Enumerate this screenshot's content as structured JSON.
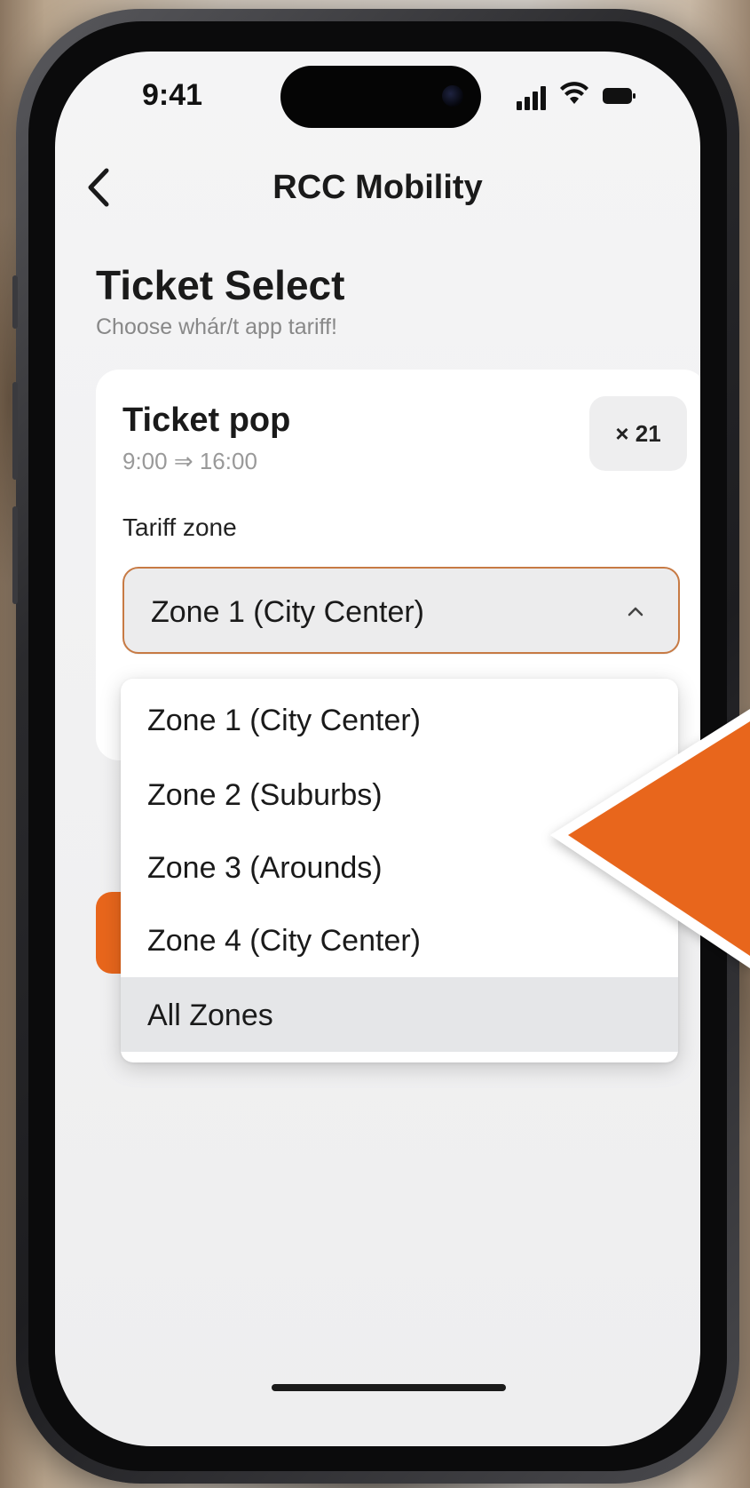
{
  "status_bar": {
    "time": "9:41"
  },
  "nav": {
    "title": "RCC Mobility"
  },
  "page": {
    "title": "Ticket Select",
    "subtitle": "Choose whár/t app tariff!"
  },
  "ticket": {
    "name": "Ticket pop",
    "time_range": "9:00 ⇒ 16:00",
    "quantity": "× 21"
  },
  "tariff": {
    "label": "Tariff zone",
    "selected": "Zone 1 (City Center)",
    "options": [
      "Zone 1 (City Center)",
      "Zone 2 (Suburbs)",
      "Zone 3 (Arounds)",
      "Zone 4 (City Center)",
      "All Zones"
    ],
    "highlighted_option": "All Zones"
  },
  "colors": {
    "accent": "#e8661c",
    "select_border": "#c77a44",
    "highlight_row": "#e5e6e8"
  },
  "icons": {
    "back": "chevron-left-icon",
    "dropdown": "chevron-up-icon",
    "signal": "signal-icon",
    "wifi": "wifi-icon",
    "battery": "battery-icon",
    "pointer": "orange-arrow-pointer"
  }
}
